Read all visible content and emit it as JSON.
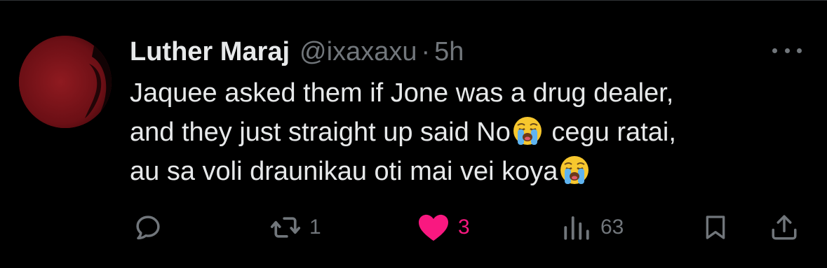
{
  "author": {
    "display_name": "Luther Maraj",
    "handle": "@ixaxaxu",
    "separator": "·",
    "time": "5h"
  },
  "tweet": {
    "lines": [
      "Jaquee asked them if Jone was a drug dealer,",
      "and they just straight up said No",
      " cegu ratai,",
      "au sa voli draunikau oti mai vei koya"
    ],
    "emoji": [
      "loudly-crying-face",
      "loudly-crying-face"
    ]
  },
  "actions": {
    "reply": {
      "icon": "reply-icon",
      "count": ""
    },
    "retweet": {
      "icon": "retweet-icon",
      "count": "1"
    },
    "like": {
      "icon": "heart-icon",
      "count": "3",
      "liked": true
    },
    "views": {
      "icon": "views-icon",
      "count": "63"
    },
    "bookmark": {
      "icon": "bookmark-icon"
    },
    "share": {
      "icon": "share-icon"
    }
  },
  "colors": {
    "background": "#000000",
    "primary_text": "#e7e9ea",
    "secondary_text": "#71767b",
    "like": "#f91880",
    "divider": "#2f3336"
  }
}
